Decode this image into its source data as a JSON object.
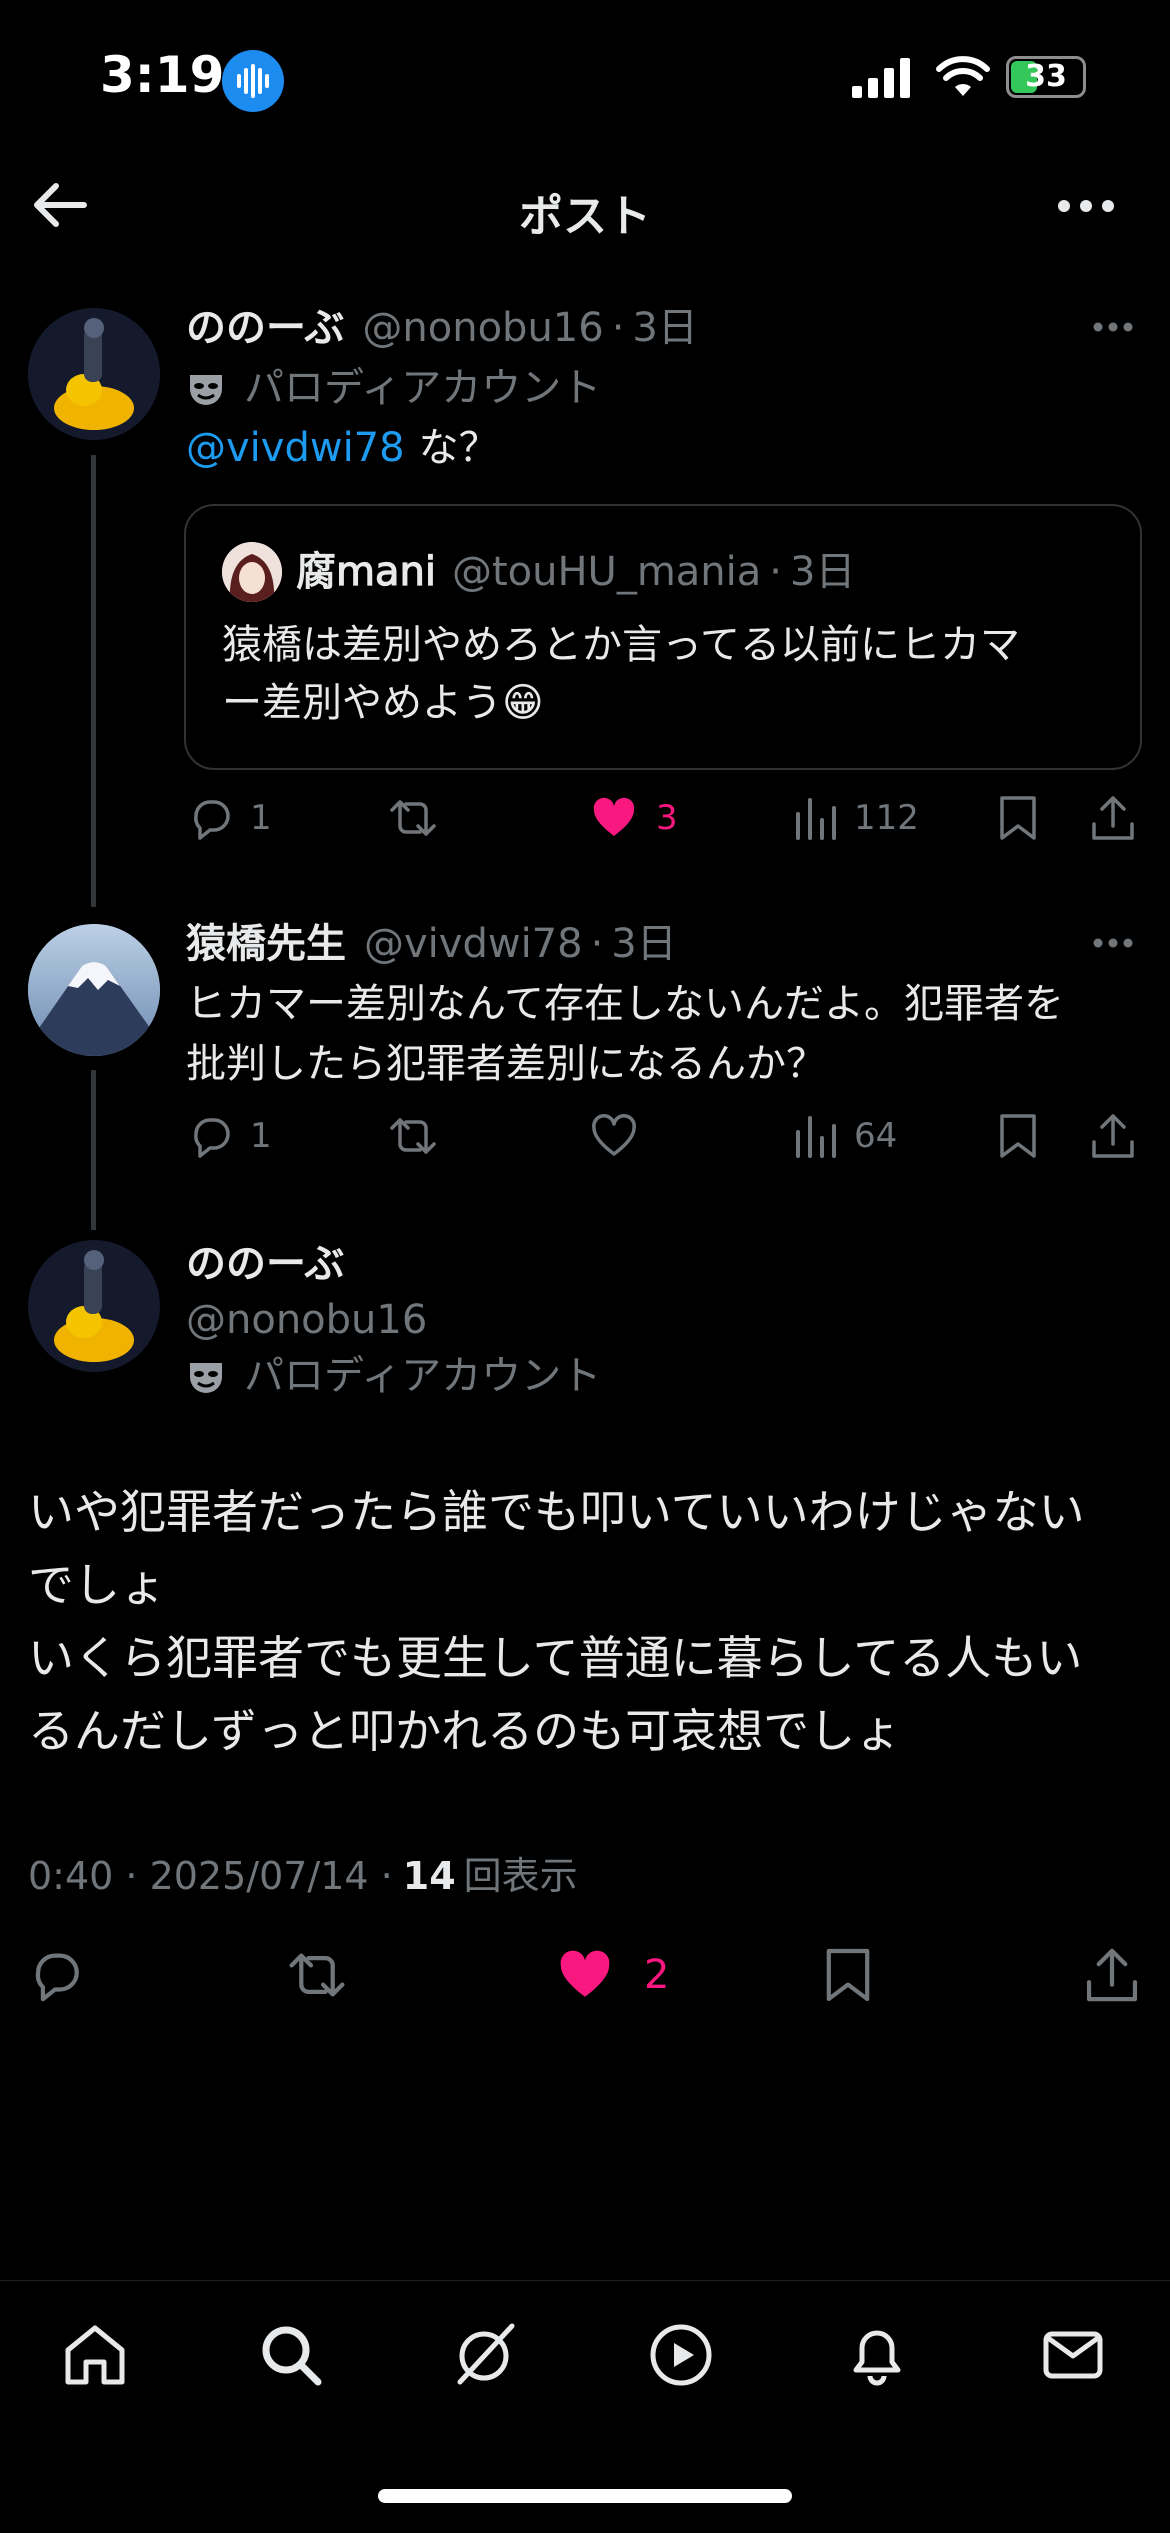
{
  "status_bar": {
    "time": "3:19",
    "battery": "33"
  },
  "header": {
    "title": "ポスト"
  },
  "posts": [
    {
      "name": "ののーぶ",
      "handle": "@nonobu16",
      "dot": "·",
      "time": "3日",
      "badge": "パロディアカウント",
      "mention": "@vivdwi78",
      "text": "な？",
      "quote": {
        "name": "腐𝗆𝖺𝗇𝗂",
        "handle": "@touHU_mania",
        "dot": "·",
        "time": "3日",
        "text_line1": "猿橋は差別やめろとか言ってる以前にヒカマ",
        "text_line2": "ー差別やめよう😁"
      },
      "replies": "1",
      "likes": "3",
      "views": "112"
    },
    {
      "name": "猿橋先生",
      "handle": "@vivdwi78",
      "dot": "·",
      "time": "3日",
      "text_line1": "ヒカマー差別なんて存在しないんだよ。犯罪者を",
      "text_line2": "批判したら犯罪者差別になるんか？",
      "replies": "1",
      "views": "64"
    }
  ],
  "main_post": {
    "name": "ののーぶ",
    "handle": "@nonobu16",
    "badge": "パロディアカウント",
    "lines": [
      "いや犯罪者だったら誰でも叩いていいわけじゃない",
      "でしょ",
      "いくら犯罪者でも更生して普通に暮らしてる人もい",
      "るんだしずっと叩かれるのも可哀想でしょ"
    ],
    "meta_time": "0:40 · 2025/07/14 · ",
    "meta_views_count": "14",
    "meta_views_label": "回表示",
    "likes": "2"
  },
  "tabbar": {
    "items": [
      "home-icon",
      "search-icon",
      "grok-icon",
      "video-icon",
      "notifications-icon",
      "messages-icon"
    ]
  },
  "colors": {
    "accent": "#1d9bf0",
    "like": "#f91880",
    "muted": "#71767b"
  }
}
